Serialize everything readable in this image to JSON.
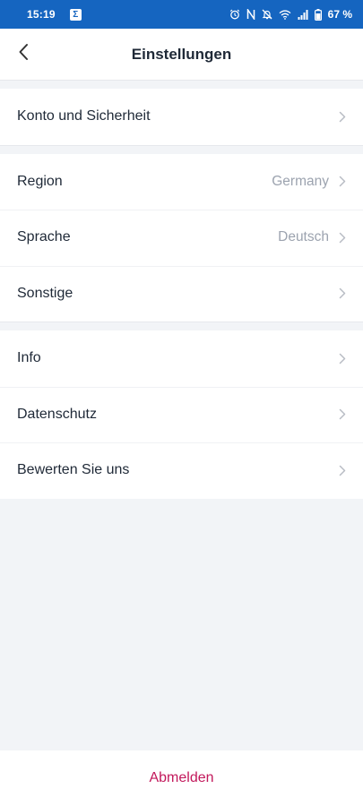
{
  "status_bar": {
    "time": "15:19",
    "app_icon_glyph": "Σ",
    "battery": "67 %",
    "icons": [
      "alarm-icon",
      "nfc-icon",
      "notifications-off-icon",
      "wifi-icon",
      "signal-icon",
      "battery-icon"
    ]
  },
  "header": {
    "title": "Einstellungen",
    "back_icon": "chevron-left-icon"
  },
  "groups": [
    {
      "items": [
        {
          "label": "Konto und Sicherheit",
          "value": ""
        }
      ]
    },
    {
      "items": [
        {
          "label": "Region",
          "value": "Germany"
        },
        {
          "label": "Sprache",
          "value": "Deutsch"
        },
        {
          "label": "Sonstige",
          "value": ""
        }
      ]
    },
    {
      "items": [
        {
          "label": "Info",
          "value": ""
        },
        {
          "label": "Datenschutz",
          "value": ""
        },
        {
          "label": "Bewerten Sie uns",
          "value": ""
        }
      ]
    }
  ],
  "footer": {
    "logout_label": "Abmelden"
  },
  "colors": {
    "status_bar": "#1565c0",
    "page_background": "#f2f4f7",
    "logout": "#c2185b",
    "secondary_text": "#9ca3af"
  }
}
